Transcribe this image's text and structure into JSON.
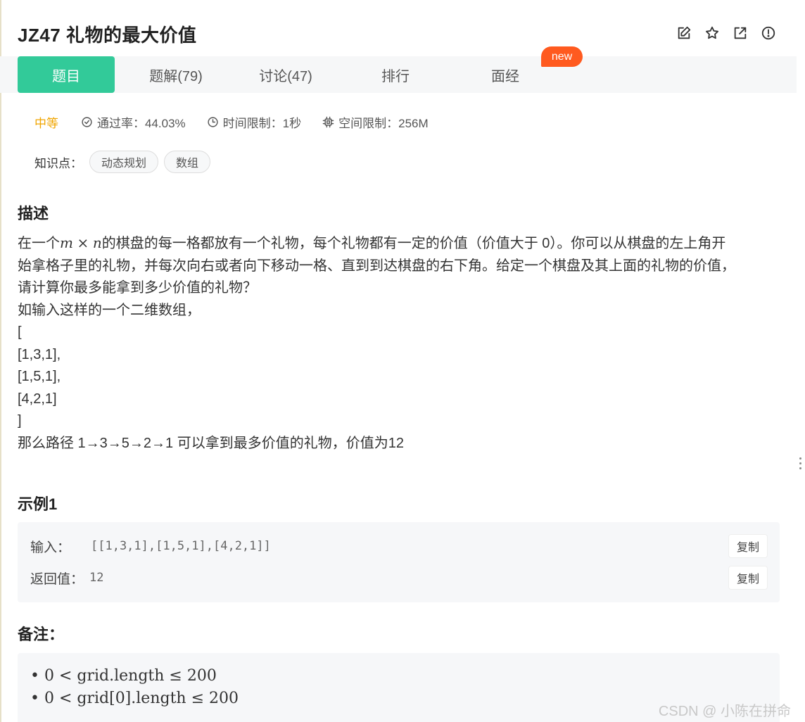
{
  "header": {
    "title": "JZ47  礼物的最大价值",
    "icons": [
      "edit-icon",
      "star-icon",
      "share-icon",
      "alert-icon"
    ]
  },
  "tabs": [
    {
      "label": "题目",
      "active": true
    },
    {
      "label": "题解(79)",
      "active": false
    },
    {
      "label": "讨论(47)",
      "active": false
    },
    {
      "label": "排行",
      "active": false
    },
    {
      "label": "面经",
      "active": false
    }
  ],
  "badge": {
    "label": "new"
  },
  "meta": {
    "difficulty": "中等",
    "pass_rate": "通过率：44.03%",
    "time_limit": "时间限制：1秒",
    "space_limit": "空间限制：256M"
  },
  "knowledge": {
    "label": "知识点：",
    "tags": [
      "动态规划",
      "数组"
    ]
  },
  "description": {
    "title": "描述",
    "line1_a": "在一个",
    "line1_m": "m",
    "line1_times": "×",
    "line1_n": "n",
    "line1_b": "的棋盘的每一格都放有一个礼物，每个礼物都有一定的价值（价值大于 0）。你可以从棋盘的左上角开",
    "line2": "始拿格子里的礼物，并每次向右或者向下移动一格、直到到达棋盘的右下角。给定一个棋盘及其上面的礼物的价值，",
    "line3": "请计算你最多能拿到多少价值的礼物？",
    "line4": "如输入这样的一个二维数组，",
    "line5": "[",
    "line6": "[1,3,1],",
    "line7": "[1,5,1],",
    "line8": "[4,2,1]",
    "line9": "]",
    "line10": "那么路径 1→3→5→2→1 可以拿到最多价值的礼物，价值为12"
  },
  "example": {
    "title": "示例1",
    "input_label": "输入：",
    "input_value": "[[1,3,1],[1,5,1],[4,2,1]]",
    "output_label": "返回值：",
    "output_value": "12",
    "copy_label": "复制"
  },
  "notes": {
    "title": "备注：",
    "line1": "• 0 < grid.length ≤ 200",
    "line2": "• 0 < grid[0].length ≤ 200"
  },
  "watermark": "CSDN @  小陈在拼命"
}
